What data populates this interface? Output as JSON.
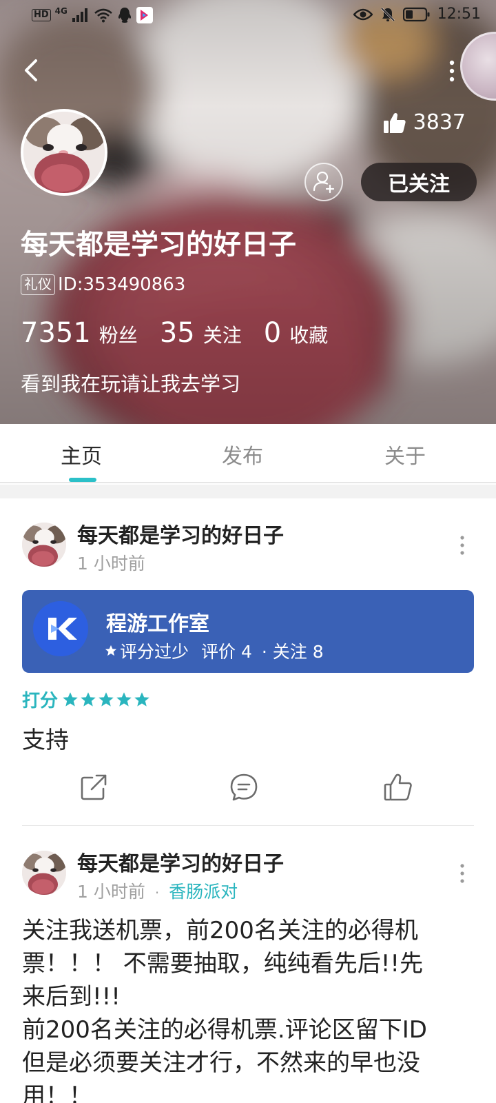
{
  "status_bar": {
    "hd": "HD",
    "signal": "4G",
    "time": "12:51"
  },
  "profile": {
    "likes": "3837",
    "follow_button": "已关注",
    "name": "每天都是学习的好日子",
    "tag": "礼仪",
    "id_text": "ID:353490863",
    "stats": [
      {
        "num": "7351",
        "label": "粉丝"
      },
      {
        "num": "35",
        "label": "关注"
      },
      {
        "num": "0",
        "label": "收藏"
      }
    ],
    "bio": "看到我在玩请让我去学习"
  },
  "tabs": [
    {
      "label": "主页",
      "active": true
    },
    {
      "label": "发布",
      "active": false
    },
    {
      "label": "关于",
      "active": false
    }
  ],
  "posts": [
    {
      "author": "每天都是学习的好日子",
      "time": "1 小时前",
      "app": {
        "name": "程游工作室",
        "rating_status": "评分过少",
        "reviews": "评价 4",
        "follows": "· 关注 8"
      },
      "rating_label": "打分",
      "rating_stars": 5,
      "text": "支持"
    },
    {
      "author": "每天都是学习的好日子",
      "time": "1 小时前",
      "sep": "·",
      "game": "香肠派对",
      "lines": [
        "关注我送机票，前200名关注的必得机",
        "票！！！ 不需要抽取，纯纯看先后!!先",
        "来后到!!!",
        "前200名关注的必得机票.评论区留下ID",
        "但是必须要关注才行，不然来的早也没",
        "用！！"
      ]
    }
  ],
  "colors": {
    "accent": "#2ab5be",
    "app_card": "#3a61b6",
    "follow_btn": "#282222"
  }
}
